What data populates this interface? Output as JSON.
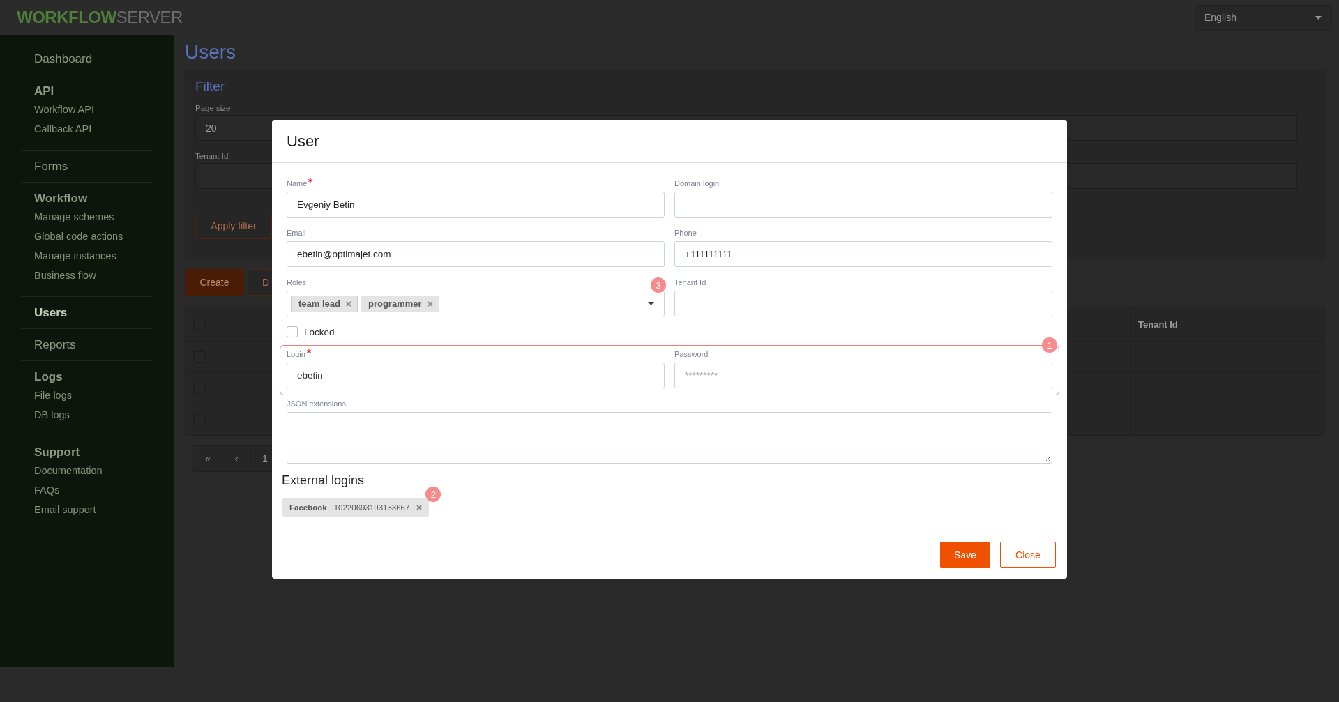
{
  "header": {
    "logo_bold": "WORKFLOW",
    "logo_light": "SERVER",
    "language": "English"
  },
  "sidebar": {
    "sections": [
      {
        "title": "Dashboard",
        "selected": false
      },
      {
        "title": "API",
        "selected": false,
        "items": [
          "Workflow API",
          "Callback API"
        ]
      },
      {
        "title": "Forms",
        "selected": false
      },
      {
        "title": "Workflow",
        "selected": false,
        "items": [
          "Manage schemes",
          "Global code actions",
          "Manage instances",
          "Business flow"
        ]
      },
      {
        "title": "Users",
        "selected": true
      },
      {
        "title": "Reports",
        "selected": false
      },
      {
        "title": "Logs",
        "selected": false,
        "items": [
          "File logs",
          "DB logs"
        ]
      },
      {
        "title": "Support",
        "selected": false,
        "items": [
          "Documentation",
          "FAQs",
          "Email support"
        ]
      }
    ]
  },
  "main": {
    "title": "Users",
    "filter": {
      "title": "Filter",
      "fields": [
        {
          "label": "Page size",
          "value": "20"
        },
        {
          "label": "Tenant Id"
        }
      ],
      "apply_button": "Apply filter"
    },
    "actions": [
      {
        "label": "Create",
        "kind": "primary"
      },
      {
        "label": "D",
        "kind": "outline"
      }
    ],
    "table": {
      "header_checked": false,
      "columns": [
        "Tenant Id"
      ],
      "rows": [
        {
          "checked": false
        },
        {
          "checked": false
        },
        {
          "checked": false
        }
      ]
    },
    "pagination": [
      "«",
      "‹",
      "1"
    ]
  },
  "dialog": {
    "title": "User",
    "rows": [
      [
        {
          "kind": "text",
          "label": "Name",
          "required": true,
          "value": "Evgeniy Betin"
        },
        {
          "kind": "text",
          "label": "Domain login",
          "required": false
        }
      ],
      [
        {
          "kind": "text",
          "label": "Email",
          "required": false,
          "value": "ebetin@optimajet.com"
        },
        {
          "kind": "text",
          "label": "Phone",
          "required": false,
          "value": "+111111111"
        }
      ],
      [
        {
          "kind": "tags",
          "label": "Roles",
          "required": false,
          "tags": [
            "team lead",
            "programmer"
          ],
          "annotation": "3"
        },
        {
          "kind": "text",
          "label": "Tenant Id",
          "required": false
        }
      ]
    ],
    "locked": {
      "label": "Locked",
      "checked": false
    },
    "highlighted_row": {
      "annotation": "1",
      "fields": [
        {
          "kind": "text",
          "label": "Login",
          "required": true,
          "value": "ebetin"
        },
        {
          "kind": "text",
          "label": "Password",
          "required": false,
          "placeholder": "*********"
        }
      ]
    },
    "json_extensions": {
      "label": "JSON extensions"
    },
    "external_logins": {
      "title": "External logins",
      "annotation": "2",
      "items": [
        {
          "provider": "Facebook",
          "id": "10220693193133667"
        }
      ]
    },
    "buttons": [
      {
        "label": "Save",
        "kind": "primary"
      },
      {
        "label": "Close",
        "kind": "outline"
      }
    ]
  }
}
